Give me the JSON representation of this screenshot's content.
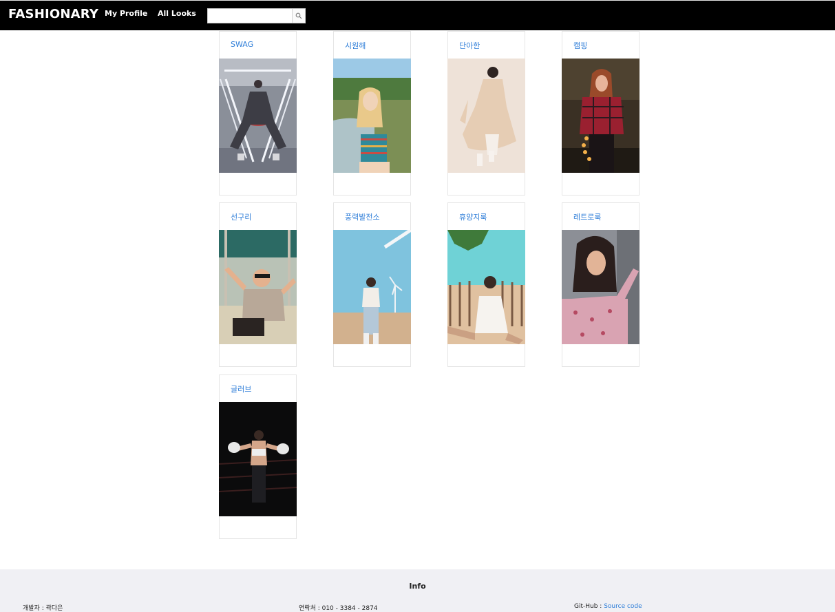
{
  "navbar": {
    "brand": "FASHIONARY",
    "links": [
      "My Profile",
      "All Looks"
    ],
    "search": {
      "value": "",
      "placeholder": "",
      "button_icon": "search-icon"
    }
  },
  "looks": [
    {
      "title": "SWAG",
      "image": "person in checkered outfit seated between neon light tubes"
    },
    {
      "title": "시원해",
      "image": "blonde woman in striped tube top outdoors"
    },
    {
      "title": "단아한",
      "image": "woman in beige tulle dress"
    },
    {
      "title": "캠핑",
      "image": "woman in red plaid shirt with string lights"
    },
    {
      "title": "선구리",
      "image": "woman in sunglasses making peace signs"
    },
    {
      "title": "풍력발전소",
      "image": "woman on beach near wind turbines"
    },
    {
      "title": "휴양지룩",
      "image": "woman in white dress sitting by wooden fence"
    },
    {
      "title": "레트로룩",
      "image": "woman in floral blouse by window"
    },
    {
      "title": "글러브",
      "image": "woman with boxing gloves in dark ring"
    }
  ],
  "footer": {
    "title": "Info",
    "developer_label": "개발자 : ",
    "developer_value": "곽다은",
    "contact_label": "연락처 : ",
    "contact_value": "010 - 3384 - 2874",
    "git_label": "Git-Hub : ",
    "git_link": "Source code"
  },
  "colors": {
    "navbar": "#000000",
    "accent_link": "#2f7ed8",
    "footer_bg": "#f0f0f4"
  }
}
